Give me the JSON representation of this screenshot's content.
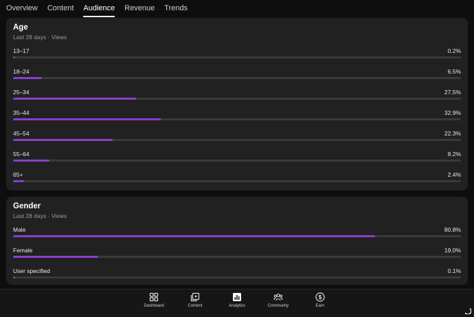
{
  "tabs": [
    {
      "label": "Overview",
      "active": false
    },
    {
      "label": "Content",
      "active": false
    },
    {
      "label": "Audience",
      "active": true
    },
    {
      "label": "Revenue",
      "active": false
    },
    {
      "label": "Trends",
      "active": false
    }
  ],
  "age": {
    "title": "Age",
    "subtitle": "Last 28 days · Views",
    "rows": [
      {
        "label": "13–17",
        "value": "0.2%",
        "fraction": 0.002
      },
      {
        "label": "18–24",
        "value": "6.5%",
        "fraction": 0.065
      },
      {
        "label": "25–34",
        "value": "27.5%",
        "fraction": 0.275
      },
      {
        "label": "35–44",
        "value": "32.9%",
        "fraction": 0.329
      },
      {
        "label": "45–54",
        "value": "22.3%",
        "fraction": 0.223
      },
      {
        "label": "55–64",
        "value": "8.2%",
        "fraction": 0.082
      },
      {
        "label": "65+",
        "value": "2.4%",
        "fraction": 0.024
      }
    ]
  },
  "gender": {
    "title": "Gender",
    "subtitle": "Last 28 days · Views",
    "rows": [
      {
        "label": "Male",
        "value": "80.8%",
        "fraction": 0.808
      },
      {
        "label": "Female",
        "value": "19.0%",
        "fraction": 0.19
      },
      {
        "label": "User specified",
        "value": "0.1%",
        "fraction": 0.001
      }
    ]
  },
  "bottom_nav": [
    {
      "label": "Dashboard",
      "icon": "dashboard-icon"
    },
    {
      "label": "Content",
      "icon": "content-icon"
    },
    {
      "label": "Analytics",
      "icon": "analytics-icon"
    },
    {
      "label": "Community",
      "icon": "community-icon"
    },
    {
      "label": "Earn",
      "icon": "dollar-icon"
    }
  ],
  "colors": {
    "bar_fill": "#8a3fc8",
    "bar_track": "#3a3a3a",
    "card_bg": "#212121",
    "page_bg": "#0e0e0e"
  }
}
